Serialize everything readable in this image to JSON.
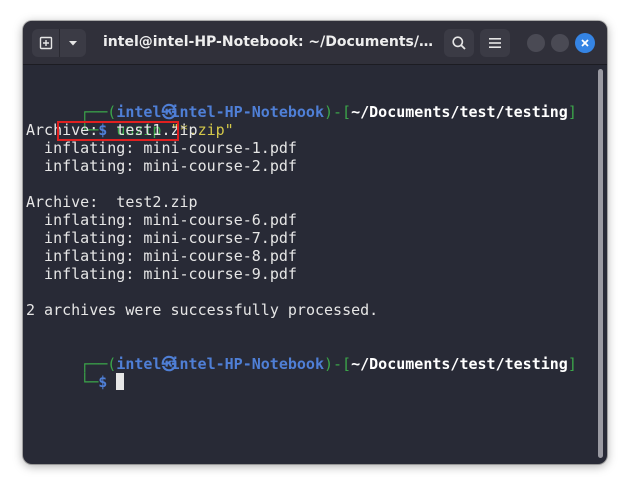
{
  "window": {
    "title": "intel@intel-HP-Notebook: ~/Documents/test/testing",
    "icons": {
      "new_tab": "new-tab-icon",
      "dropdown": "chevron-down-icon",
      "search": "search-icon",
      "menu": "hamburger-menu-icon",
      "close": "close-icon"
    }
  },
  "terminal": {
    "prompt1": {
      "open": "┌──(",
      "user": "intel",
      "skull": "㉿",
      "host": "intel-HP-Notebook",
      "mid": ")-[",
      "path": "~/Documents/test/testing",
      "close": "]",
      "corner": "└─",
      "dollar": "$ ",
      "command": "unzip",
      "argument": "\"*.zip\""
    },
    "output": [
      "Archive:  test1.zip",
      "  inflating: mini-course-1.pdf",
      "  inflating: mini-course-2.pdf",
      "",
      "Archive:  test2.zip",
      "  inflating: mini-course-6.pdf",
      "  inflating: mini-course-7.pdf",
      "  inflating: mini-course-8.pdf",
      "  inflating: mini-course-9.pdf",
      "",
      "2 archives were successfully processed."
    ],
    "prompt2": {
      "open": "┌──(",
      "user": "intel",
      "skull": "㉿",
      "host": "intel-HP-Notebook",
      "mid": ")-[",
      "path": "~/Documents/test/testing",
      "close": "]",
      "corner": "└─",
      "dollar": "$ "
    }
  },
  "colors": {
    "terminal_bg": "#282a36",
    "prompt_green": "#3ba64a",
    "prompt_blue": "#4f7fd6",
    "string_yellow": "#d4c84a",
    "highlight_red": "#e02020",
    "close_blue": "#3584e4"
  }
}
